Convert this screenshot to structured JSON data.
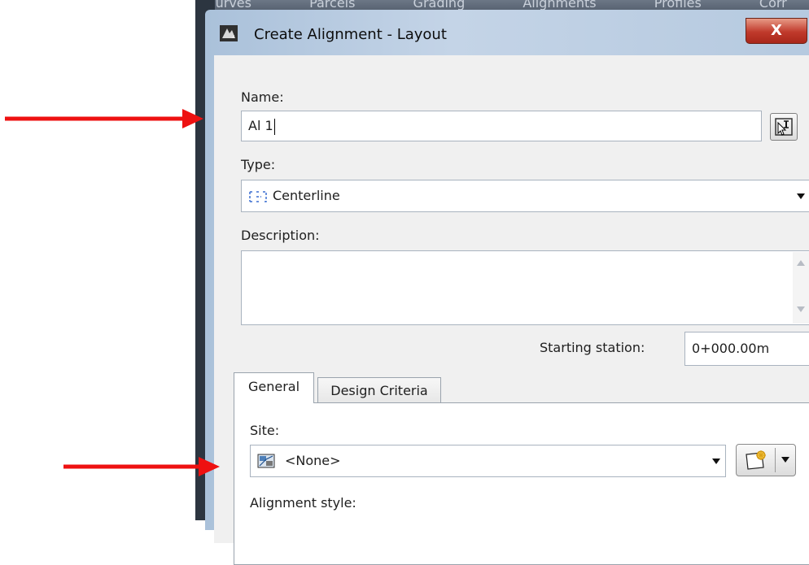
{
  "backdrop": {
    "tabs": [
      "s Curves",
      "Parcels",
      "Grading",
      "Alignments",
      "Profiles",
      "Corr"
    ]
  },
  "dialog": {
    "title": "Create Alignment - Layout",
    "close_label": "X",
    "name_label": "Name:",
    "name_value": "Al 1",
    "type_label": "Type:",
    "type_value": "Centerline",
    "description_label": "Description:",
    "description_value": "",
    "starting_station_label": "Starting station:",
    "starting_station_value": "0+000.00m",
    "tabs": [
      {
        "label": "General",
        "active": true
      },
      {
        "label": "Design Criteria",
        "active": false
      }
    ],
    "site_label": "Site:",
    "site_value": "<None>",
    "alignment_style_label": "Alignment style:"
  },
  "colors": {
    "annotation_arrow": "#ee1111",
    "close_button": "#c0392b",
    "title_gradient": "#b5c9df"
  },
  "icons": {
    "app": "civil3d-app-icon",
    "pick": "pick-from-drawing-icon",
    "type": "centerline-type-icon",
    "site": "site-icon",
    "create_site": "create-site-icon"
  }
}
